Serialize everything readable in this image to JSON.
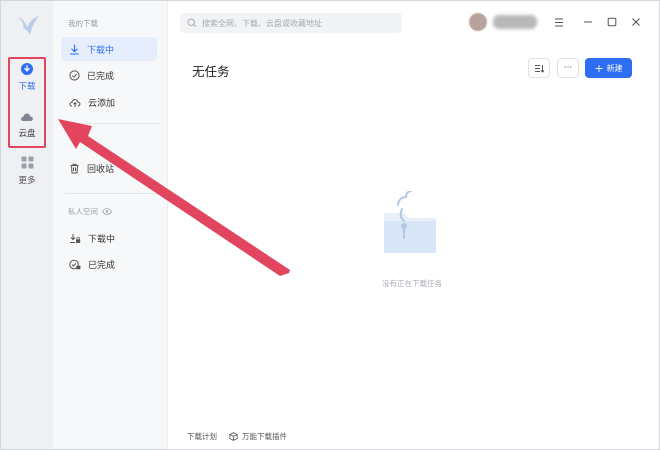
{
  "rail": {
    "download_label": "下载",
    "cloud_label": "云盘",
    "more_label": "更多"
  },
  "nav": {
    "my_downloads_section": "我的下载",
    "items": [
      {
        "label": "下载中"
      },
      {
        "label": "已完成"
      },
      {
        "label": "云添加"
      },
      {
        "label": "回收站"
      }
    ],
    "private_section": "私人空间",
    "private_items": [
      {
        "label": "下载中"
      },
      {
        "label": "已完成"
      }
    ]
  },
  "search": {
    "placeholder": "搜索全网、下载、云盘或收藏地址"
  },
  "main": {
    "title": "无任务",
    "new_button": "新建",
    "more_button": "···",
    "empty_text": "没有正在下载任务"
  },
  "footer": {
    "schedule": "下载计划",
    "plugin": "万能下载插件"
  },
  "colors": {
    "accent": "#2d6df2",
    "annotation": "#e2465f"
  }
}
